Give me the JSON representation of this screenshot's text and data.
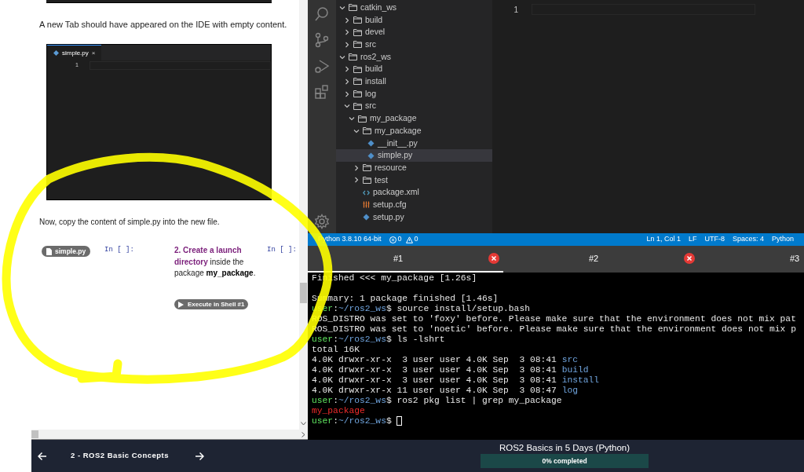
{
  "tutorial": {
    "intro": "A new Tab should have appeared on the IDE with empty content.",
    "screenshot": {
      "tab": "simple.py",
      "close": "×",
      "line_number": "1"
    },
    "instruction": "Now, copy the content of simple.py into the new file.",
    "file_badge": "simple.py",
    "cells": [
      {
        "prompt": "In [ ]:"
      },
      {
        "prompt": "In [ ]:"
      }
    ],
    "step": {
      "title": "2. Create a launch directory",
      "text": " inside the package ",
      "package": "my_package",
      "end": "."
    },
    "execute_button": "Execute in Shell #1"
  },
  "ide": {
    "explorer": [
      {
        "label": "catkin_ws",
        "kind": "folder",
        "expanded": true,
        "selected": false,
        "children": [
          {
            "label": "build",
            "kind": "folder",
            "expanded": false,
            "selected": false
          },
          {
            "label": "devel",
            "kind": "folder",
            "expanded": false,
            "selected": false
          },
          {
            "label": "src",
            "kind": "folder",
            "expanded": false,
            "selected": false
          }
        ]
      },
      {
        "label": "ros2_ws",
        "kind": "folder",
        "expanded": true,
        "selected": false,
        "children": [
          {
            "label": "build",
            "kind": "folder",
            "expanded": false,
            "selected": false
          },
          {
            "label": "install",
            "kind": "folder",
            "expanded": false,
            "selected": false
          },
          {
            "label": "log",
            "kind": "folder",
            "expanded": false,
            "selected": false
          },
          {
            "label": "src",
            "kind": "folder",
            "expanded": true,
            "selected": false,
            "children": [
              {
                "label": "my_package",
                "kind": "folder",
                "expanded": true,
                "selected": false,
                "children": [
                  {
                    "label": "my_package",
                    "kind": "folder",
                    "expanded": true,
                    "selected": false,
                    "children": [
                      {
                        "label": "__init__.py",
                        "kind": "python",
                        "selected": false
                      },
                      {
                        "label": "simple.py",
                        "kind": "python",
                        "selected": true
                      }
                    ]
                  },
                  {
                    "label": "resource",
                    "kind": "folder",
                    "expanded": false,
                    "selected": false
                  },
                  {
                    "label": "test",
                    "kind": "folder",
                    "expanded": false,
                    "selected": false
                  },
                  {
                    "label": "package.xml",
                    "kind": "xml",
                    "selected": false
                  },
                  {
                    "label": "setup.cfg",
                    "kind": "config",
                    "selected": false
                  },
                  {
                    "label": "setup.py",
                    "kind": "python",
                    "selected": false
                  }
                ]
              }
            ]
          }
        ]
      }
    ],
    "editor": {
      "line_number": "1"
    },
    "status_bar": {
      "interpreter": "Python 3.8.10 64-bit",
      "errors": "0",
      "warnings": "0",
      "position": "Ln 1, Col 1",
      "eol": "LF",
      "encoding": "UTF-8",
      "indent": "Spaces: 4",
      "language": "Python"
    }
  },
  "terminal": {
    "tabs": [
      {
        "label": "#1",
        "selected": true,
        "closable": true
      },
      {
        "label": "#2",
        "selected": false,
        "closable": true
      },
      {
        "label": "#3",
        "selected": false,
        "closable": false
      }
    ],
    "lines": [
      [
        {
          "text": "Finished <<< my_package [1.26s]",
          "kind": "plain"
        }
      ],
      [
        {
          "kind": "blank"
        }
      ],
      [
        {
          "text": "Summary: 1 package finished [1.46s]",
          "kind": "plain"
        }
      ],
      [
        {
          "text": "user",
          "kind": "user"
        },
        {
          "text": ":",
          "kind": "plain"
        },
        {
          "text": "~/ros2_ws",
          "kind": "path"
        },
        {
          "text": "$ source install/setup.bash",
          "kind": "plain"
        }
      ],
      [
        {
          "text": "ROS_DISTRO was set to 'foxy' before. Please make sure that the environment does not mix pat",
          "kind": "plain"
        }
      ],
      [
        {
          "text": "ROS_DISTRO was set to 'noetic' before. Please make sure that the environment does not mix p",
          "kind": "plain"
        }
      ],
      [
        {
          "text": "user",
          "kind": "user"
        },
        {
          "text": ":",
          "kind": "plain"
        },
        {
          "text": "~/ros2_ws",
          "kind": "path"
        },
        {
          "text": "$ ls -lshrt",
          "kind": "plain"
        }
      ],
      [
        {
          "text": "total 16K",
          "kind": "plain"
        }
      ],
      [
        {
          "text": "4.0K drwxr-xr-x  3 user user 4.0K Sep  3 08:41 ",
          "kind": "plain"
        },
        {
          "text": "src",
          "kind": "dir"
        }
      ],
      [
        {
          "text": "4.0K drwxr-xr-x  3 user user 4.0K Sep  3 08:41 ",
          "kind": "plain"
        },
        {
          "text": "build",
          "kind": "dir"
        }
      ],
      [
        {
          "text": "4.0K drwxr-xr-x  3 user user 4.0K Sep  3 08:41 ",
          "kind": "plain"
        },
        {
          "text": "install",
          "kind": "dir"
        }
      ],
      [
        {
          "text": "4.0K drwxr-xr-x 11 user user 4.0K Sep  3 08:47 ",
          "kind": "plain"
        },
        {
          "text": "log",
          "kind": "dir"
        }
      ],
      [
        {
          "text": "user",
          "kind": "user"
        },
        {
          "text": ":",
          "kind": "plain"
        },
        {
          "text": "~/ros2_ws",
          "kind": "path"
        },
        {
          "text": "$ ros2 pkg list | grep my_package",
          "kind": "plain"
        }
      ],
      [
        {
          "text": "my_package",
          "kind": "match"
        }
      ],
      [
        {
          "text": "user",
          "kind": "user"
        },
        {
          "text": ":",
          "kind": "plain"
        },
        {
          "text": "~/ros2_ws",
          "kind": "path"
        },
        {
          "text": "$ ",
          "kind": "plain"
        }
      ]
    ],
    "cursor": true
  },
  "course_bar": {
    "chapter": "2 - ROS2 Basic Concepts",
    "title": "ROS2 Basics in 5 Days (Python)",
    "progress": {
      "label": "0% completed",
      "level": 0
    }
  }
}
